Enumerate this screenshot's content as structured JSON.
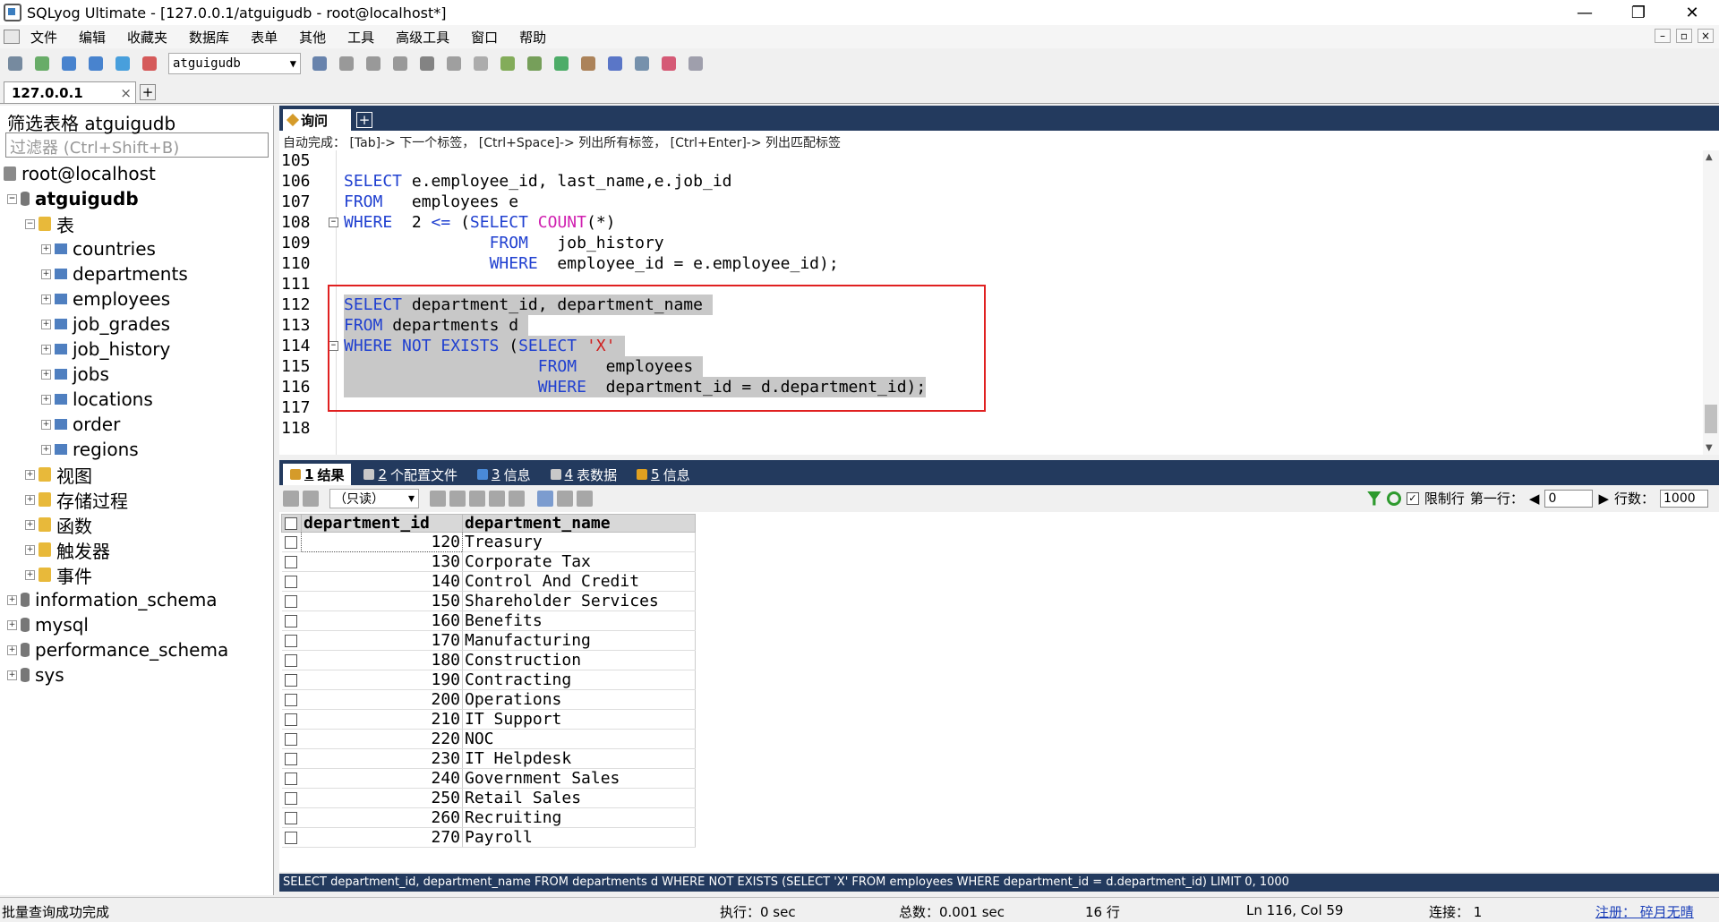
{
  "window": {
    "title": "SQLyog Ultimate - [127.0.0.1/atguigudb - root@localhost*]",
    "controls": [
      "—",
      "❐",
      "✕"
    ]
  },
  "menu": [
    "文件",
    "编辑",
    "收藏夹",
    "数据库",
    "表单",
    "其他",
    "工具",
    "高级工具",
    "窗口",
    "帮助"
  ],
  "toolbar": {
    "db_select": "atguigudb"
  },
  "connection_tab": {
    "label": "127.0.0.1",
    "close": "×"
  },
  "sidebar": {
    "filter_title": "筛选表格 atguigudb",
    "filter_placeholder": "过滤器 (Ctrl+Shift+B)",
    "tree": {
      "root": "root@localhost",
      "db": "atguigudb",
      "tables_folder": "表",
      "tables": [
        "countries",
        "departments",
        "employees",
        "job_grades",
        "job_history",
        "jobs",
        "locations",
        "order",
        "regions"
      ],
      "folders": [
        "视图",
        "存储过程",
        "函数",
        "触发器",
        "事件"
      ],
      "other_dbs": [
        "information_schema",
        "mysql",
        "performance_schema",
        "sys"
      ]
    }
  },
  "editor": {
    "tab_label": "询问",
    "hint": "自动完成：  [Tab]-> 下一个标签，  [Ctrl+Space]-> 列出所有标签，  [Ctrl+Enter]-> 列出匹配标签",
    "lines": [
      {
        "n": "105",
        "tokens": []
      },
      {
        "n": "106",
        "tokens": [
          {
            "t": "kw",
            "v": "SELECT"
          },
          {
            "t": "",
            "v": " e.employee_id, last_name,e.job_id"
          }
        ]
      },
      {
        "n": "107",
        "tokens": [
          {
            "t": "kw",
            "v": "FROM"
          },
          {
            "t": "",
            "v": "   employees e"
          }
        ]
      },
      {
        "n": "108",
        "fold": true,
        "tokens": [
          {
            "t": "kw",
            "v": "WHERE"
          },
          {
            "t": "",
            "v": "  2 "
          },
          {
            "t": "kw",
            "v": "<="
          },
          {
            "t": "",
            "v": " ("
          },
          {
            "t": "kw",
            "v": "SELECT"
          },
          {
            "t": "",
            "v": " "
          },
          {
            "t": "fn",
            "v": "COUNT"
          },
          {
            "t": "",
            "v": "(*)"
          }
        ]
      },
      {
        "n": "109",
        "tokens": [
          {
            "t": "",
            "v": "               "
          },
          {
            "t": "kw",
            "v": "FROM"
          },
          {
            "t": "",
            "v": "   job_history"
          }
        ]
      },
      {
        "n": "110",
        "tokens": [
          {
            "t": "",
            "v": "               "
          },
          {
            "t": "kw",
            "v": "WHERE"
          },
          {
            "t": "",
            "v": "  employee_id = e.employee_id);"
          }
        ]
      },
      {
        "n": "111",
        "tokens": []
      },
      {
        "n": "112",
        "sel": true,
        "tokens": [
          {
            "t": "kw",
            "v": "SELECT"
          },
          {
            "t": "",
            "v": " department_id, department_name "
          }
        ]
      },
      {
        "n": "113",
        "sel": true,
        "tokens": [
          {
            "t": "kw",
            "v": "FROM"
          },
          {
            "t": "",
            "v": " departments d "
          }
        ]
      },
      {
        "n": "114",
        "sel": true,
        "fold": true,
        "tokens": [
          {
            "t": "kw",
            "v": "WHERE NOT EXISTS"
          },
          {
            "t": "",
            "v": " ("
          },
          {
            "t": "kw",
            "v": "SELECT"
          },
          {
            "t": "",
            "v": " "
          },
          {
            "t": "str",
            "v": "'X'"
          },
          {
            "t": "",
            "v": " "
          }
        ]
      },
      {
        "n": "115",
        "sel": true,
        "tokens": [
          {
            "t": "",
            "v": "                    "
          },
          {
            "t": "kw",
            "v": "FROM"
          },
          {
            "t": "",
            "v": "   employees "
          }
        ]
      },
      {
        "n": "116",
        "sel": true,
        "tokens": [
          {
            "t": "",
            "v": "                    "
          },
          {
            "t": "kw",
            "v": "WHERE"
          },
          {
            "t": "",
            "v": "  department_id = d.department_id);"
          }
        ]
      },
      {
        "n": "117",
        "tokens": []
      },
      {
        "n": "118",
        "tokens": []
      }
    ]
  },
  "result_tabs": [
    {
      "num": "1",
      "label": "结果",
      "active": true,
      "color": "#d59b2a"
    },
    {
      "num": "2",
      "label": "个配置文件",
      "color": "#c8c8c8"
    },
    {
      "num": "3",
      "label": "信息",
      "color": "#4a8ad8"
    },
    {
      "num": "4",
      "label": "表数据",
      "color": "#c8c8c8"
    },
    {
      "num": "5",
      "label": "信息",
      "color": "#e0a020"
    }
  ],
  "result_toolbar": {
    "readonly": "（只读）",
    "limit_label": "限制行",
    "limit_checked": true,
    "first_row_label": "第一行：",
    "first_row": "0",
    "row_count_label": "行数：",
    "row_count": "1000"
  },
  "grid": {
    "columns": [
      "department_id",
      "department_name"
    ],
    "rows": [
      [
        "120",
        "Treasury"
      ],
      [
        "130",
        "Corporate Tax"
      ],
      [
        "140",
        "Control And Credit"
      ],
      [
        "150",
        "Shareholder Services"
      ],
      [
        "160",
        "Benefits"
      ],
      [
        "170",
        "Manufacturing"
      ],
      [
        "180",
        "Construction"
      ],
      [
        "190",
        "Contracting"
      ],
      [
        "200",
        "Operations"
      ],
      [
        "210",
        "IT Support"
      ],
      [
        "220",
        "NOC"
      ],
      [
        "230",
        "IT Helpdesk"
      ],
      [
        "240",
        "Government Sales"
      ],
      [
        "250",
        "Retail Sales"
      ],
      [
        "260",
        "Recruiting"
      ],
      [
        "270",
        "Payroll"
      ]
    ]
  },
  "sql_status": "SELECT department_id, department_name FROM departments d WHERE NOT EXISTS (SELECT 'X' FROM employees WHERE department_id = d.department_id) LIMIT 0, 1000",
  "status": {
    "message": "批量查询成功完成",
    "exec": "执行：0 sec",
    "total": "总数：0.001 sec",
    "rows": "16 行",
    "position": "Ln 116, Col 59",
    "connection": "连接：  1",
    "register": "注册：  碎月无晴"
  }
}
